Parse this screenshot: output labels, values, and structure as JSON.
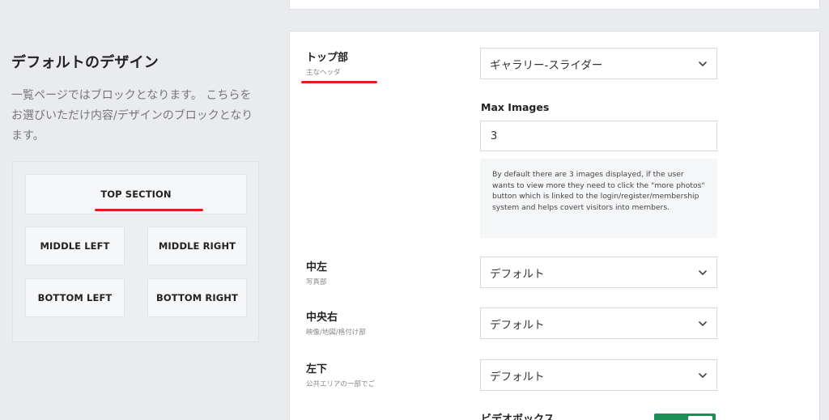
{
  "left": {
    "title": "デフォルトのデザイン",
    "description": "一覧ページではブロックとなります。 こちらをお選びいただけ内容/デザインのブロックとなります。",
    "sections": {
      "top": "TOP SECTION",
      "middle_left": "MIDDLE LEFT",
      "middle_right": "MIDDLE RIGHT",
      "bottom_left": "BOTTOM LEFT",
      "bottom_right": "BOTTOM RIGHT"
    }
  },
  "panel": {
    "top": {
      "label": "トップ部",
      "sub": "主なヘッダ",
      "value": "ギャラリー-スライダー"
    },
    "max_images": {
      "label": "Max Images",
      "value": "3"
    },
    "info": "By default there are 3 images displayed, if the user wants to view more they need to click the \"more photos\" button which is linked to the login/register/membership system and helps covert visitors into members.",
    "middle_left": {
      "label": "中左",
      "sub": "写真部",
      "value": "デフォルト"
    },
    "middle_right": {
      "label": "中央右",
      "sub": "映像/地図/格付け部",
      "value": "デフォルト"
    },
    "bottom_left": {
      "label": "左下",
      "sub": "公共エリアの一部でご",
      "value": "デフォルト"
    },
    "video_box": {
      "label": "ビデオボックス",
      "enabled": true
    }
  },
  "colors": {
    "accent_red": "#e31b1b",
    "toggle_green": "#1a8f55"
  },
  "icons": {
    "select_chevron": "chevron-down-icon"
  }
}
